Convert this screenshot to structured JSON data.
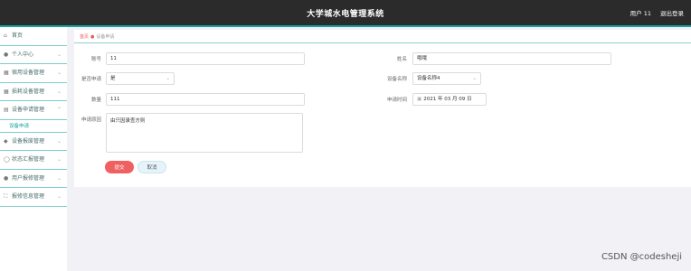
{
  "header": {
    "title": "大学城水电管理系统",
    "user": "用户 11",
    "logout": "退出登录"
  },
  "sidebar": {
    "items": [
      {
        "icon": "⌂",
        "label": "首页"
      },
      {
        "icon": "●",
        "label": "个人中心"
      },
      {
        "icon": "▦",
        "label": "宿用设备管理"
      },
      {
        "icon": "▦",
        "label": "损耗设备管理"
      },
      {
        "icon": "▤",
        "label": "设备申请管理"
      }
    ],
    "sub_item": "设备申请",
    "items2": [
      {
        "icon": "◆",
        "label": "设备报废管理"
      },
      {
        "icon": "◯",
        "label": "状态汇报管理"
      },
      {
        "icon": "●",
        "label": "用户报修管理"
      },
      {
        "icon": "⛶",
        "label": "报修信息管理"
      }
    ]
  },
  "breadcrumb": {
    "home": "首页",
    "current": "设备申请"
  },
  "form": {
    "account_label": "账号",
    "account_value": "11",
    "name_label": "姓名",
    "name_value": "哦哦",
    "apply_label": "是否申请",
    "apply_value": "是",
    "device_label": "设备名称",
    "device_value": "设备名称4",
    "qty_label": "数量",
    "qty_value": "111",
    "date_label": "申请时间",
    "date_value": "2021 年 03 月 09 日",
    "reason_label": "申请原因",
    "reason_value": "由只因录查方则",
    "submit_label": "提交",
    "cancel_label": "取消"
  },
  "watermark": "CSDN @codesheji"
}
